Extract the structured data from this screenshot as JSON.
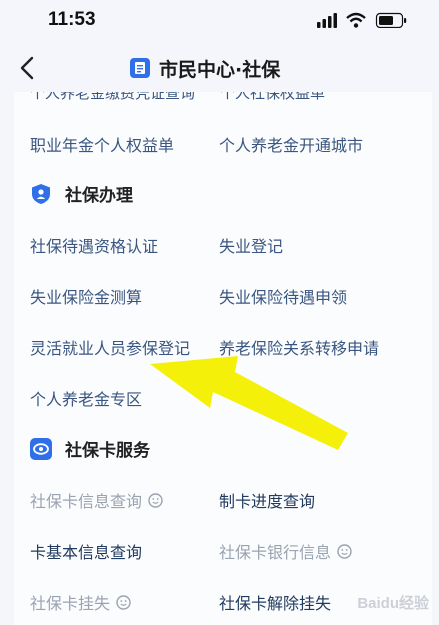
{
  "status_bar": {
    "time": "11:53"
  },
  "nav": {
    "title": "市民中心·社保",
    "back_icon": "chevron-left-icon",
    "title_icon": "document-icon"
  },
  "cut_off_row": {
    "left": "个人养老金缴费凭证查询",
    "right": "个人社保权益单"
  },
  "top_rows": [
    {
      "left": "职业年金个人权益单",
      "right": "个人养老金开通城市"
    }
  ],
  "section_social_security": {
    "title": "社保办理",
    "icon": "shield-icon",
    "accent": "#2f6fe8",
    "items": [
      "社保待遇资格认证",
      "失业登记",
      "失业保险金测算",
      "失业保险待遇申领",
      "灵活就业人员参保登记",
      "养老保险关系转移申请",
      "个人养老金专区"
    ]
  },
  "section_card": {
    "title": "社保卡服务",
    "icon": "card-icon",
    "accent": "#2f6fe8",
    "items": [
      "社保卡信息查询",
      "制卡进度查询",
      "卡基本信息查询",
      "社保卡银行信息",
      "社保卡挂失",
      "社保卡解除挂失"
    ]
  },
  "annotation": {
    "arrow_color": "#f5f00a"
  },
  "watermark": "Baidu经验"
}
